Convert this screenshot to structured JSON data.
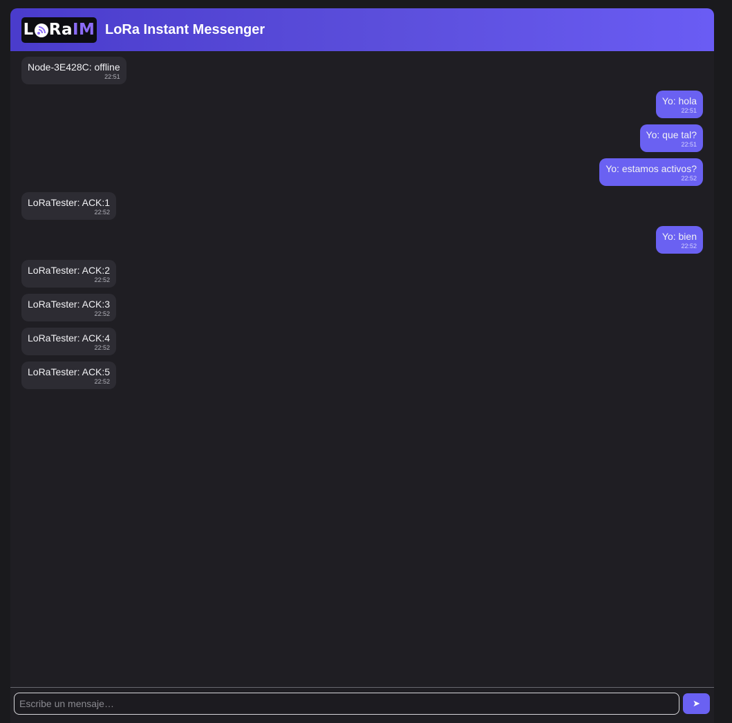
{
  "header": {
    "logo": {
      "part1": "L",
      "part2": "Ra",
      "part3": "IM"
    },
    "title": "LoRa Instant Messenger"
  },
  "messages": [
    {
      "direction": "in",
      "text": "Node-3E428C: offline",
      "time": "22:51"
    },
    {
      "direction": "out",
      "text": "Yo: hola",
      "time": "22:51"
    },
    {
      "direction": "out",
      "text": "Yo: que tal?",
      "time": "22:51"
    },
    {
      "direction": "out",
      "text": "Yo: estamos activos?",
      "time": "22:52"
    },
    {
      "direction": "in",
      "text": "LoRaTester: ACK:1",
      "time": "22:52"
    },
    {
      "direction": "out",
      "text": "Yo: bien",
      "time": "22:52"
    },
    {
      "direction": "in",
      "text": "LoRaTester: ACK:2",
      "time": "22:52"
    },
    {
      "direction": "in",
      "text": "LoRaTester: ACK:3",
      "time": "22:52"
    },
    {
      "direction": "in",
      "text": "LoRaTester: ACK:4",
      "time": "22:52"
    },
    {
      "direction": "in",
      "text": "LoRaTester: ACK:5",
      "time": "22:52"
    }
  ],
  "composer": {
    "placeholder": "Escribe un mensaje…",
    "value": "",
    "send_label": "➤"
  },
  "colors": {
    "accent": "#6a61f2",
    "header_start": "#4a3ccc",
    "header_end": "#6a5cf4",
    "incoming_bubble": "#2d2c33",
    "background": "#1f1e23"
  }
}
